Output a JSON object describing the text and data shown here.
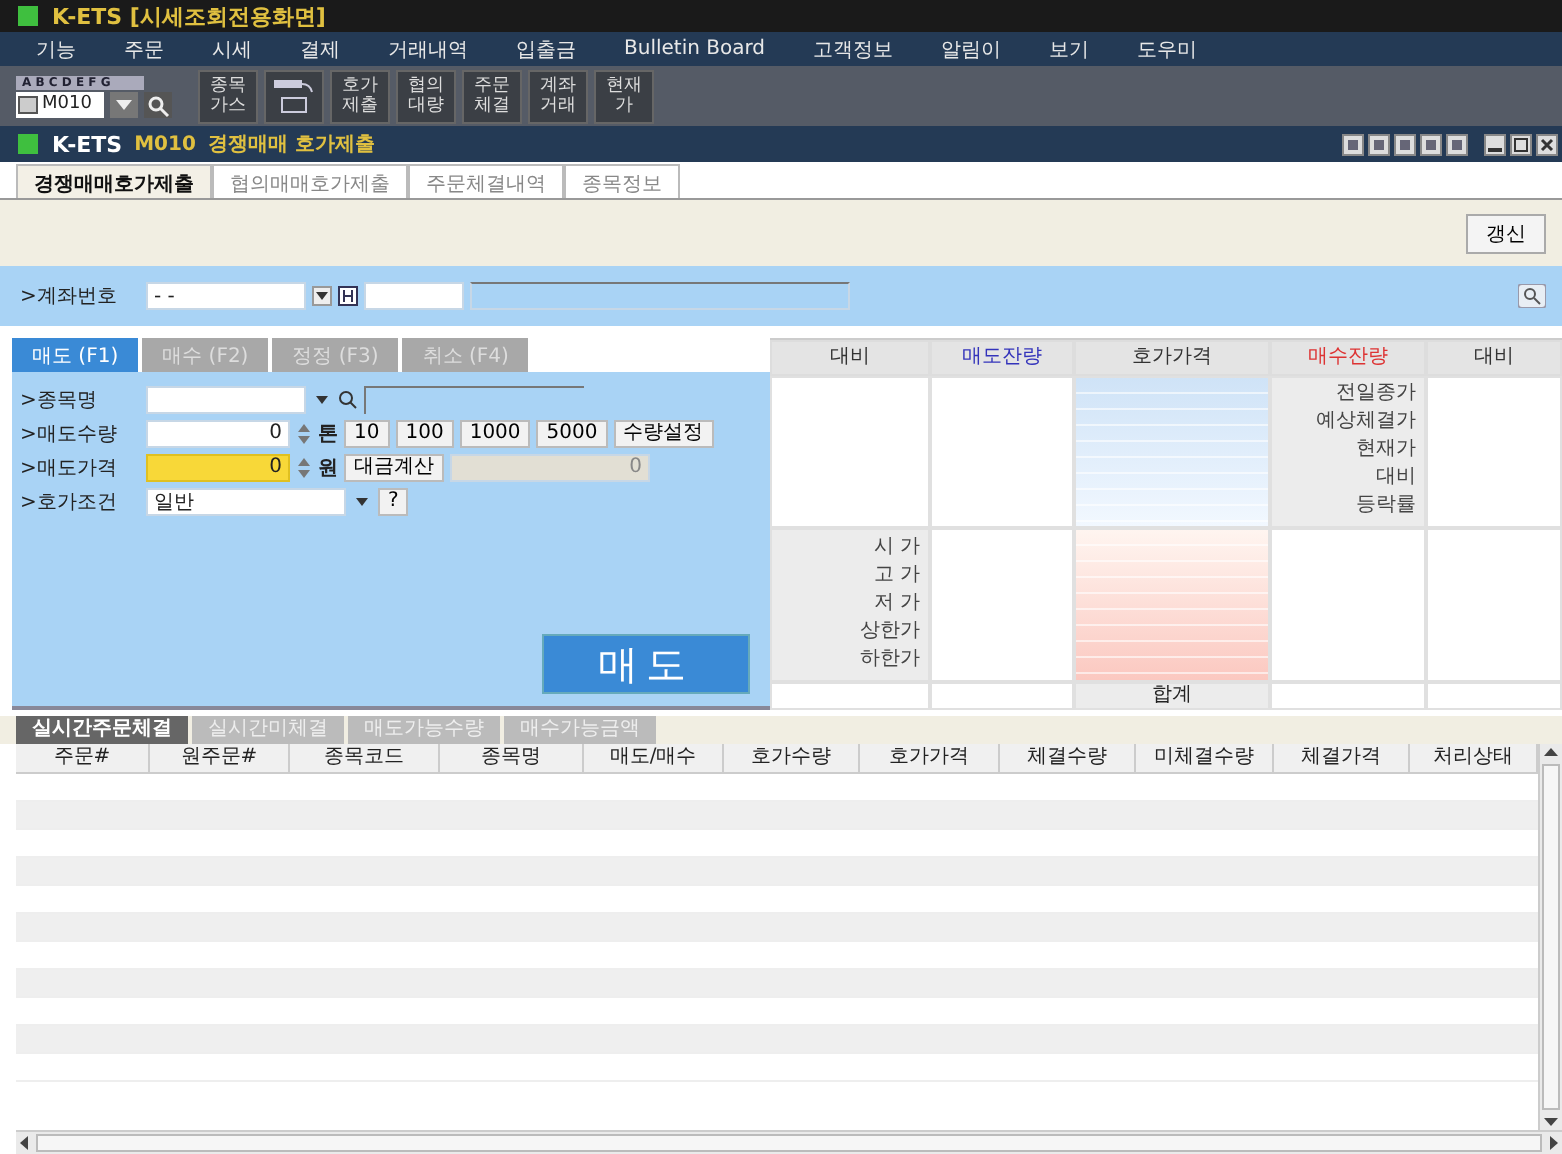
{
  "window": {
    "title": "K-ETS [시세조회전용화면]"
  },
  "menu": [
    "기능",
    "주문",
    "시세",
    "결제",
    "거래내역",
    "입출금",
    "Bulletin Board",
    "고객정보",
    "알림이",
    "보기",
    "도우미"
  ],
  "toolbar": {
    "letters": "A B C D E F G",
    "screen_code": "M010",
    "buttons": [
      {
        "kind": "text",
        "label": "종목 가스"
      },
      {
        "kind": "icon"
      },
      {
        "kind": "text",
        "label": "호가 제출"
      },
      {
        "kind": "text",
        "label": "협의 대량"
      },
      {
        "kind": "text",
        "label": "주문 체결"
      },
      {
        "kind": "text",
        "label": "계좌 거래"
      },
      {
        "kind": "text",
        "label": "현재 가"
      }
    ]
  },
  "screen": {
    "app": "K-ETS",
    "code": "M010",
    "title": "경쟁매매 호가제출"
  },
  "tabs": [
    {
      "label": "경쟁매매호가제출",
      "selected": true
    },
    {
      "label": "협의매매호가제출",
      "selected": false
    },
    {
      "label": "주문체결내역",
      "selected": false
    },
    {
      "label": "종목정보",
      "selected": false
    }
  ],
  "refresh_button": "갱신",
  "account": {
    "label": ">계좌번호",
    "value": "- -"
  },
  "order_form": {
    "tabs": [
      {
        "label": "매도 (F1)",
        "selected": true
      },
      {
        "label": "매수 (F2)",
        "selected": false
      },
      {
        "label": "정정 (F3)",
        "selected": false
      },
      {
        "label": "취소 (F4)",
        "selected": false
      }
    ],
    "stock_label": ">종목명",
    "quantity": {
      "label": ">매도수량",
      "value": "0",
      "unit": "톤",
      "presets": [
        "10",
        "100",
        "1000",
        "5000"
      ],
      "set_button": "수량설정"
    },
    "price": {
      "label": ">매도가격",
      "value": "0",
      "unit": "원",
      "calc_button": "대금계산",
      "amount": "0"
    },
    "condition": {
      "label": ">호가조건",
      "value": "일반",
      "help": "?"
    },
    "submit": "매도"
  },
  "order_book": {
    "columns": [
      {
        "label": "대비",
        "color": "#333333"
      },
      {
        "label": "매도잔량",
        "color": "#3333bb"
      },
      {
        "label": "호가가격",
        "color": "#333333"
      },
      {
        "label": "매수잔량",
        "color": "#dd3333"
      },
      {
        "label": "대비",
        "color": "#333333"
      }
    ],
    "info_labels": [
      "전일종가",
      "예상체결가",
      "현재가",
      "대비",
      "등락률"
    ],
    "price_labels": [
      "시 가",
      "고 가",
      "저 가",
      "상한가",
      "하한가"
    ],
    "total_label": "합계"
  },
  "bottom_tabs": [
    {
      "label": "실시간주문체결",
      "selected": true
    },
    {
      "label": "실시간미체결",
      "selected": false
    },
    {
      "label": "매도가능수량",
      "selected": false
    },
    {
      "label": "매수가능금액",
      "selected": false
    }
  ],
  "table": {
    "columns": [
      "주문#",
      "원주문#",
      "종목코드",
      "종목명",
      "매도/매수",
      "호가수량",
      "호가가격",
      "체결수량",
      "미체결수량",
      "체결가격",
      "처리상태"
    ]
  }
}
